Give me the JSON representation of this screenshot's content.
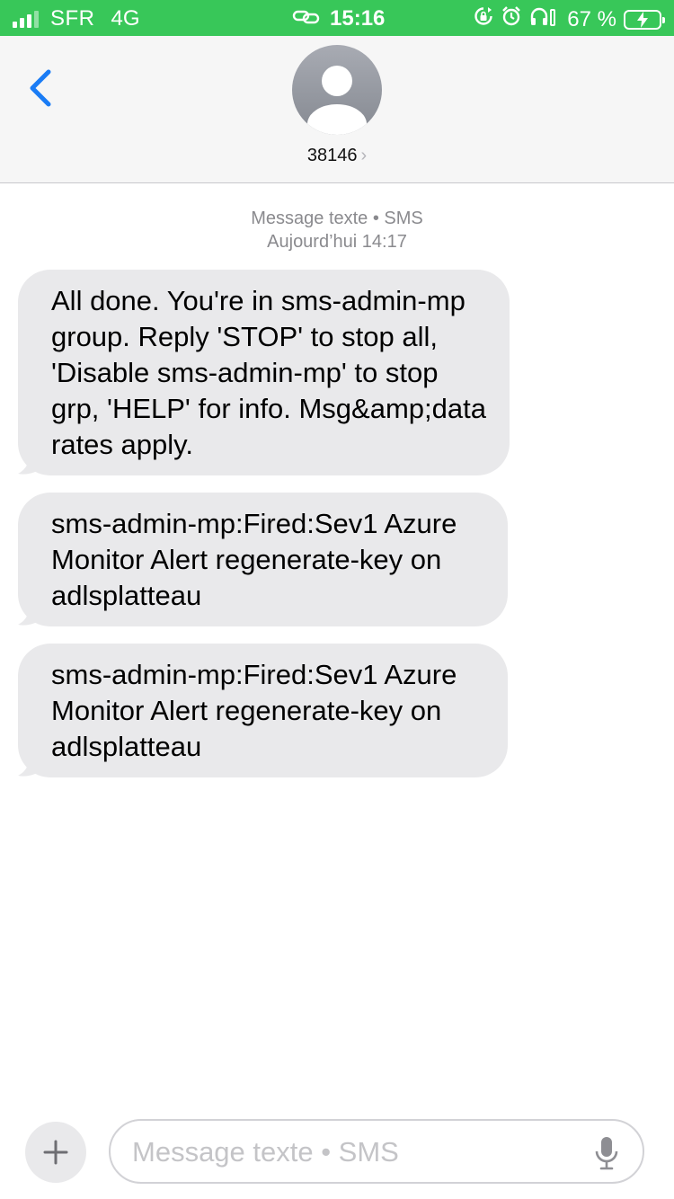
{
  "status_bar": {
    "carrier": "SFR",
    "network": "4G",
    "time": "15:16",
    "battery_percent": "67 %",
    "bg_color": "#38c759"
  },
  "header": {
    "contact": "38146",
    "icons": [
      "back-chevron-icon",
      "person-icon",
      "chevron-right-icon"
    ]
  },
  "conversation": {
    "meta_line1": "Message texte • SMS",
    "meta_line2": "Aujourd’hui 14:17",
    "messages": [
      {
        "text": "All done. You're in sms-admin-mp group. Reply 'STOP' to stop all, 'Disable sms-admin-mp' to stop grp, 'HELP' for info. Msg&amp;data rates apply."
      },
      {
        "text": "sms-admin-mp:Fired:Sev1 Azure Monitor Alert regenerate-key on adlsplatteau"
      },
      {
        "text": "sms-admin-mp:Fired:Sev1 Azure Monitor Alert regenerate-key on adlsplatteau"
      }
    ]
  },
  "composer": {
    "placeholder": "Message texte • SMS",
    "value": "",
    "icons": [
      "plus-icon",
      "microphone-icon"
    ]
  },
  "colors": {
    "accent": "#1a7cf5",
    "bubble": "#e9e9eb",
    "meta_text": "#8a8a8e"
  }
}
